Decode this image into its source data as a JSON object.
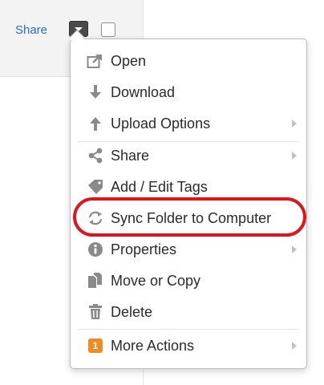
{
  "row": {
    "share_label": "Share"
  },
  "menu": {
    "items": [
      {
        "label": "Open",
        "icon": "open-icon",
        "submenu": false
      },
      {
        "label": "Download",
        "icon": "download-icon",
        "submenu": false
      },
      {
        "label": "Upload Options",
        "icon": "upload-icon",
        "submenu": true
      },
      {
        "label": "Share",
        "icon": "share-icon",
        "submenu": true
      },
      {
        "label": "Add / Edit Tags",
        "icon": "tag-icon",
        "submenu": false
      },
      {
        "label": "Sync Folder to Computer",
        "icon": "sync-icon",
        "submenu": false
      },
      {
        "label": "Properties",
        "icon": "info-icon",
        "submenu": true
      },
      {
        "label": "Move or Copy",
        "icon": "copy-icon",
        "submenu": false
      },
      {
        "label": "Delete",
        "icon": "trash-icon",
        "submenu": false
      },
      {
        "label": "More Actions",
        "icon": "more-actions-badge",
        "badge": "1",
        "submenu": true
      }
    ]
  },
  "colors": {
    "link": "#2d6fb6",
    "highlight": "#e0141c",
    "badge": "#f08a24",
    "icon": "#8a8a8a"
  }
}
